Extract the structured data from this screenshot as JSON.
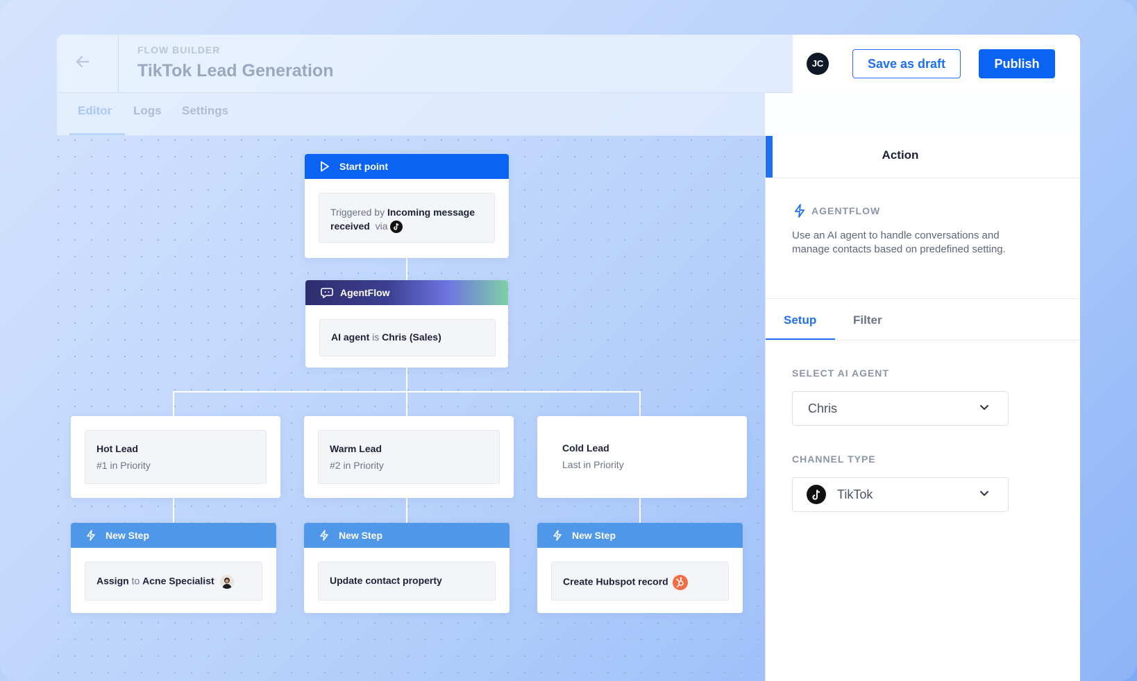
{
  "header": {
    "back_icon": "arrow-left-icon",
    "section_label": "FLOW BUILDER",
    "title": "TikTok Lead Generation",
    "avatar_initials": "JC",
    "save_draft_label": "Save as draft",
    "publish_label": "Publish"
  },
  "tabs": [
    {
      "label": "Editor",
      "active": true
    },
    {
      "label": "Logs",
      "active": false
    },
    {
      "label": "Settings",
      "active": false
    }
  ],
  "flow": {
    "start": {
      "header": "Start point",
      "icon": "play-icon",
      "prefix": "Triggered by",
      "trigger": "Incoming message",
      "trigger_2": "received",
      "via": "via",
      "channel_icon": "tiktok-icon"
    },
    "agent": {
      "header": "AgentFlow",
      "icon": "chat-bot-icon",
      "subject": "AI agent",
      "verb": "is",
      "value": "Chris (Sales)"
    },
    "branches": [
      {
        "title": "Hot Lead",
        "subtitle": "#1 in Priority"
      },
      {
        "title": "Warm Lead",
        "subtitle": "#2 in Priority"
      },
      {
        "title": "Cold Lead",
        "subtitle": "Last in Priority"
      }
    ],
    "steps": [
      {
        "header": "New Step",
        "icon": "lightning-icon",
        "text": "Assign",
        "connector": "to",
        "target": "Acne Specialist",
        "trailing_icon": "person-avatar"
      },
      {
        "header": "New Step",
        "icon": "lightning-icon",
        "text": "Update contact property"
      },
      {
        "header": "New Step",
        "icon": "lightning-icon",
        "text": "Create Hubspot record",
        "trailing_icon": "hubspot-icon"
      }
    ]
  },
  "panel": {
    "title": "Action",
    "category_label": "AGENTFLOW",
    "category_icon": "lightning-icon",
    "description": "Use an AI agent to handle conversations and manage contacts based on predefined setting.",
    "tabs": [
      {
        "label": "Setup",
        "active": true
      },
      {
        "label": "Filter",
        "active": false
      }
    ],
    "select_agent_label": "SELECT AI AGENT",
    "select_agent_value": "Chris",
    "channel_type_label": "CHANNEL TYPE",
    "channel_type_value": "TikTok"
  },
  "colors": {
    "primary": "#0a63f2",
    "step_header": "#4f97e8",
    "hubspot": "#f36c42"
  }
}
